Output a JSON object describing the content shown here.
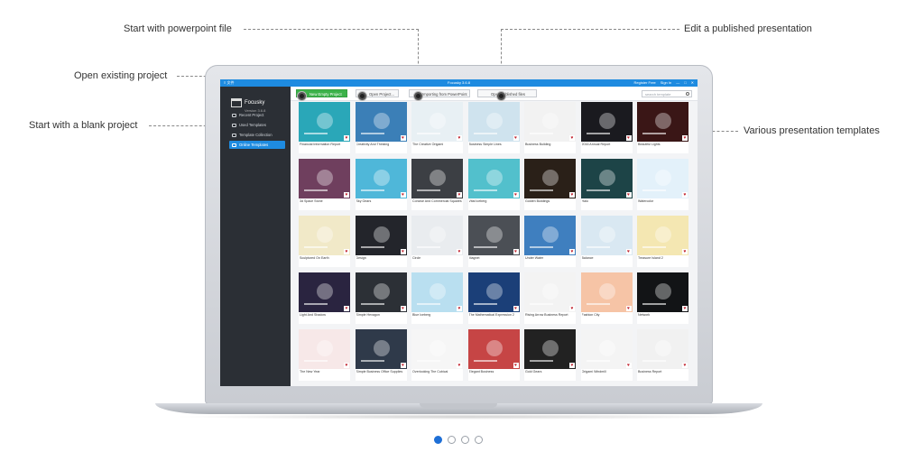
{
  "callouts": {
    "start_ppt": "Start with powerpoint file",
    "edit_published": "Edit a published presentation",
    "open_existing": "Open existing project",
    "blank_project": "Start with a blank project",
    "templates": "Various presentation templates"
  },
  "app": {
    "menu_label": "≡ 文件",
    "title": "Focusky 3.6.8",
    "top_right": [
      "Register Free",
      "Sign In",
      "—",
      "□",
      "✕"
    ]
  },
  "sidebar": {
    "logo_name": "Focusky",
    "logo_version": "Version 3.6.8",
    "items": [
      {
        "label": "Recent Project"
      },
      {
        "label": "Used Templates"
      },
      {
        "label": "Template Collection"
      },
      {
        "label": "Online Templates"
      }
    ]
  },
  "toolbar": {
    "new_project": "New Empty Project",
    "open_project": "Open Project...",
    "from_ppt": "Importing from PowerPoint",
    "open_published": "Open published files",
    "search_placeholder": "search template"
  },
  "templates": [
    {
      "name": "Financial Information Report",
      "bg": "#2aa7b8"
    },
    {
      "name": "Creativity And Thinking",
      "bg": "#3b7fb7"
    },
    {
      "name": "The Creative Origami",
      "bg": "#e8f0f4"
    },
    {
      "name": "Business Simple Lines",
      "bg": "#cfe3ee"
    },
    {
      "name": "Business Building",
      "bg": "#f2f2f2"
    },
    {
      "name": "2016 Annual Report",
      "bg": "#1a1a1f"
    },
    {
      "name": "Beautiful Lights",
      "bg": "#3a1616"
    },
    {
      "name": "3d Space Stone",
      "bg": "#6f3f5e"
    },
    {
      "name": "Sky Gears",
      "bg": "#4fb7d9"
    },
    {
      "name": "Concise And Commercial Squares",
      "bg": "#3c3f44"
    },
    {
      "name": "Vital Iceberg",
      "bg": "#52c0cc"
    },
    {
      "name": "Golden Buildings",
      "bg": "#2a2018"
    },
    {
      "name": "Halo",
      "bg": "#1d4447"
    },
    {
      "name": "Watercolor",
      "bg": "#e3f1fa"
    },
    {
      "name": "Sculptured On Earth",
      "bg": "#f1e9c8"
    },
    {
      "name": "Design",
      "bg": "#23252b"
    },
    {
      "name": "Circle",
      "bg": "#e9ecef"
    },
    {
      "name": "Magnet",
      "bg": "#4b4f55"
    },
    {
      "name": "Under Water",
      "bg": "#3f7fbf"
    },
    {
      "name": "Balance",
      "bg": "#d9e8f2"
    },
    {
      "name": "Treasure Island 2",
      "bg": "#f4e7b2"
    },
    {
      "name": "Light And Shadow",
      "bg": "#2a2440"
    },
    {
      "name": "Simple Hexagon",
      "bg": "#2c3036"
    },
    {
      "name": "Blue Iceberg",
      "bg": "#b9dff0"
    },
    {
      "name": "The Mathematical Expression 2",
      "bg": "#1b3f78"
    },
    {
      "name": "Rising Arrow Business Report",
      "bg": "#f3f3f3"
    },
    {
      "name": "Fashion City",
      "bg": "#f6c4a6"
    },
    {
      "name": "Network",
      "bg": "#121416"
    },
    {
      "name": "The New Year",
      "bg": "#f7e8e8"
    },
    {
      "name": "Simple Business Office Supplies",
      "bg": "#2f3a4a"
    },
    {
      "name": "Overlooking The Cubical",
      "bg": "#f6f6f6"
    },
    {
      "name": "Elegant Business",
      "bg": "#c64545"
    },
    {
      "name": "Gold Gears",
      "bg": "#222222"
    },
    {
      "name": "Origami Windmill",
      "bg": "#f4f4f4"
    },
    {
      "name": "Business Report",
      "bg": "#f1f1f1"
    }
  ],
  "pager": {
    "pages": 4,
    "current": 1
  }
}
